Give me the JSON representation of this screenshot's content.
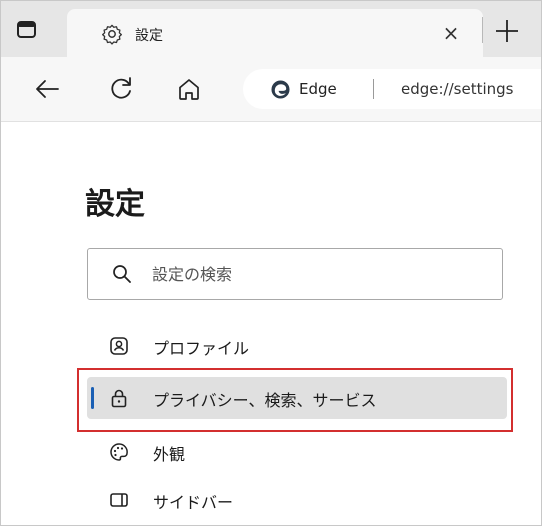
{
  "tab": {
    "title": "設定",
    "close_glyph": "×",
    "new_tab_glyph": "+"
  },
  "toolbar": {
    "address": {
      "site_name": "Edge",
      "url": "edge://settings"
    }
  },
  "settings": {
    "title": "設定",
    "search_placeholder": "設定の検索",
    "nav_items": [
      {
        "label": "プロファイル",
        "icon": "profile-icon",
        "active": false
      },
      {
        "label": "プライバシー、検索、サービス",
        "icon": "lock-icon",
        "active": true
      },
      {
        "label": "外観",
        "icon": "palette-icon",
        "active": false
      },
      {
        "label": "サイドバー",
        "icon": "sidebar-icon",
        "active": false
      }
    ]
  },
  "colors": {
    "accent": "#1a5fb4",
    "highlight_border": "#d32f2f",
    "tabstrip_bg": "#e6e6e6",
    "toolbar_bg": "#f7f7f7"
  }
}
